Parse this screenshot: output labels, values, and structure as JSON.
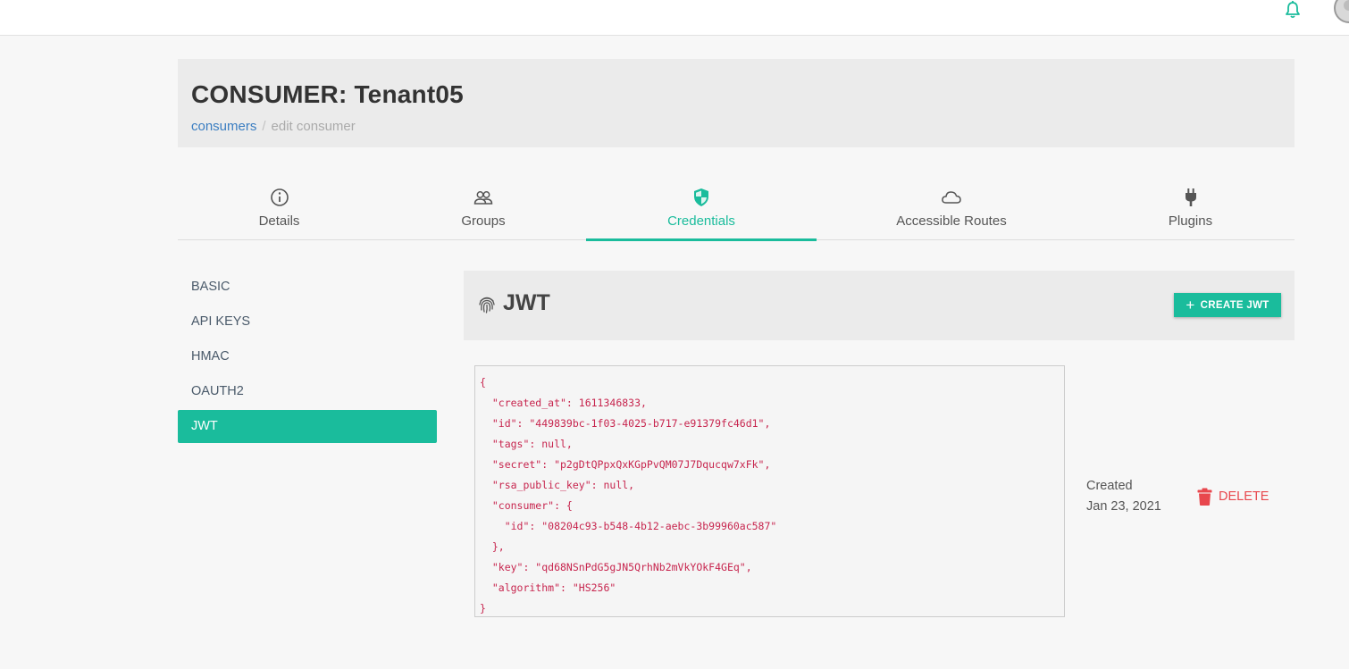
{
  "header": {
    "title": "CONSUMER: Tenant05",
    "breadcrumb": {
      "link": "consumers",
      "separator": "/",
      "current": "edit consumer"
    }
  },
  "topbar": {
    "icons": [
      "bell-icon",
      "avatar"
    ]
  },
  "tabs": [
    {
      "label": "Details",
      "icon": "info-icon"
    },
    {
      "label": "Groups",
      "icon": "users-icon"
    },
    {
      "label": "Credentials",
      "icon": "shield-icon",
      "active": true
    },
    {
      "label": "Accessible Routes",
      "icon": "cloud-icon"
    },
    {
      "label": "Plugins",
      "icon": "plug-icon"
    }
  ],
  "sidenav": {
    "items": [
      {
        "label": "BASIC"
      },
      {
        "label": "API KEYS"
      },
      {
        "label": "HMAC"
      },
      {
        "label": "OAUTH2"
      },
      {
        "label": "JWT",
        "active": true
      }
    ]
  },
  "jwt": {
    "title": "JWT",
    "create_label": "CREATE JWT",
    "code": "{\n  \"created_at\": 1611346833,\n  \"id\": \"449839bc-1f03-4025-b717-e91379fc46d1\",\n  \"tags\": null,\n  \"secret\": \"p2gDtQPpxQxKGpPvQM07J7Dqucqw7xFk\",\n  \"rsa_public_key\": null,\n  \"consumer\": {\n    \"id\": \"08204c93-b548-4b12-aebc-3b99960ac587\"\n  },\n  \"key\": \"qd68NSnPdG5gJN5QrhNb2mVkYOkF4GEq\",\n  \"algorithm\": \"HS256\"\n}",
    "created_label": "Created",
    "created_date": "Jan 23, 2021",
    "delete_label": "DELETE"
  },
  "colors": {
    "accent": "#1abc9c",
    "danger": "#e8474d",
    "link": "#3a7dc1",
    "code": "#c7254e"
  }
}
